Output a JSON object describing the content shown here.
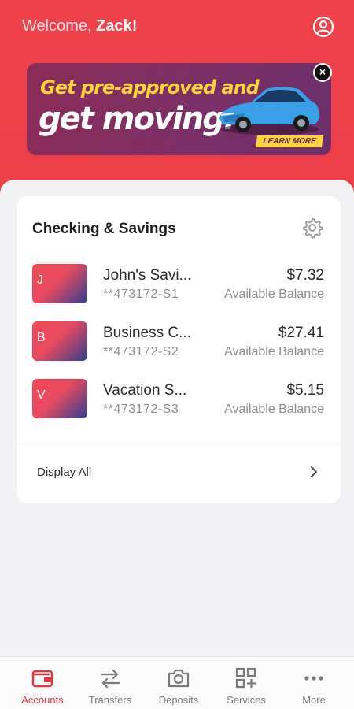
{
  "header": {
    "welcome_prefix": "Welcome, ",
    "user_name": "Zack!",
    "profile_icon": "user-circle-icon"
  },
  "banner": {
    "line1": "Get pre-approved and",
    "line2": "get moving.",
    "cta": "LEARN MORE",
    "close_icon": "close-icon"
  },
  "accounts_card": {
    "title": "Checking & Savings",
    "settings_icon": "gear-icon",
    "accounts": [
      {
        "initial": "J",
        "name": "John's Savi...",
        "number": "**473172-S1",
        "balance": "$7.32",
        "balance_label": "Available Balance"
      },
      {
        "initial": "B",
        "name": "Business C...",
        "number": "**473172-S2",
        "balance": "$27.41",
        "balance_label": "Available Balance"
      },
      {
        "initial": "V",
        "name": "Vacation S...",
        "number": "**473172-S3",
        "balance": "$5.15",
        "balance_label": "Available Balance"
      }
    ],
    "display_all": "Display All"
  },
  "tabbar": {
    "tabs": [
      {
        "label": "Accounts",
        "icon": "wallet-icon",
        "active": true
      },
      {
        "label": "Transfers",
        "icon": "transfer-arrows-icon",
        "active": false
      },
      {
        "label": "Deposits",
        "icon": "camera-icon",
        "active": false
      },
      {
        "label": "Services",
        "icon": "grid-plus-icon",
        "active": false
      },
      {
        "label": "More",
        "icon": "more-dots-icon",
        "active": false
      }
    ]
  },
  "colors": {
    "brand_red": "#ee3d46",
    "active_tab": "#e8343e",
    "banner_yellow": "#ffd33a"
  }
}
